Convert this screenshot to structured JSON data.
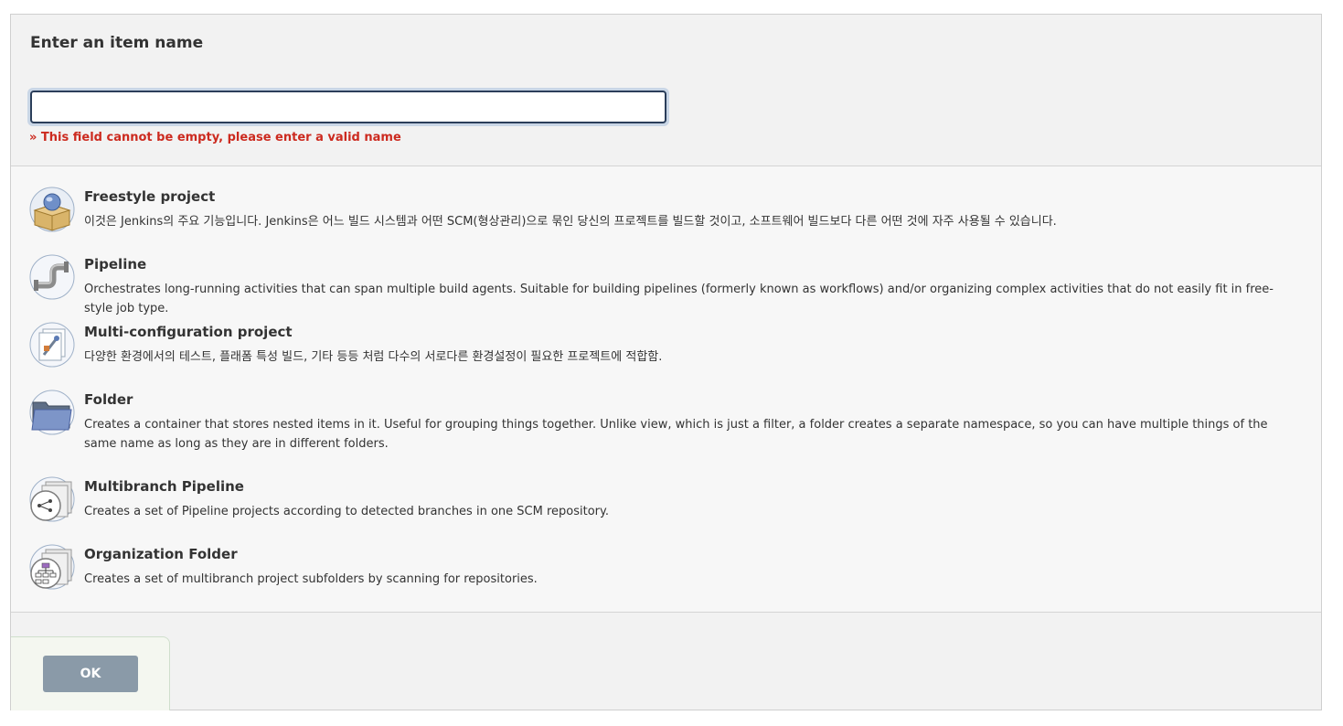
{
  "header": {
    "title": "Enter an item name",
    "input_value": "",
    "error_message": "» This field cannot be empty, please enter a valid name"
  },
  "items": [
    {
      "title": "Freestyle project",
      "description": "이것은 Jenkins의 주요 기능입니다. Jenkins은 어느 빌드 시스템과 어떤 SCM(형상관리)으로 묶인 당신의 프로젝트를 빌드할 것이고, 소프트웨어 빌드보다 다른 어떤 것에 자주 사용될 수 있습니다.",
      "icon": "freestyle-project-icon"
    },
    {
      "title": "Pipeline",
      "description": "Orchestrates long-running activities that can span multiple build agents. Suitable for building pipelines (formerly known as workflows) and/or organizing complex activities that do not easily fit in free-style job type.",
      "icon": "pipeline-icon"
    },
    {
      "title": "Multi-configuration project",
      "description": "다양한 환경에서의 테스트, 플래폼 특성 빌드, 기타 등등 처럼 다수의 서로다른 환경설정이 필요한 프로젝트에 적합함.",
      "icon": "multi-configuration-icon"
    },
    {
      "title": "Folder",
      "description": "Creates a container that stores nested items in it. Useful for grouping things together. Unlike view, which is just a filter, a folder creates a separate namespace, so you can have multiple things of the same name as long as they are in different folders.",
      "icon": "folder-icon"
    },
    {
      "title": "Multibranch Pipeline",
      "description": "Creates a set of Pipeline projects according to detected branches in one SCM repository.",
      "icon": "multibranch-pipeline-icon"
    },
    {
      "title": "Organization Folder",
      "description": "Creates a set of multibranch project subfolders by scanning for repositories.",
      "icon": "organization-folder-icon"
    }
  ],
  "footer": {
    "ok_label": "OK"
  },
  "colors": {
    "error": "#cc2a1f",
    "ok_button": "#8a9aa8",
    "input_border": "#2b3e5a"
  }
}
